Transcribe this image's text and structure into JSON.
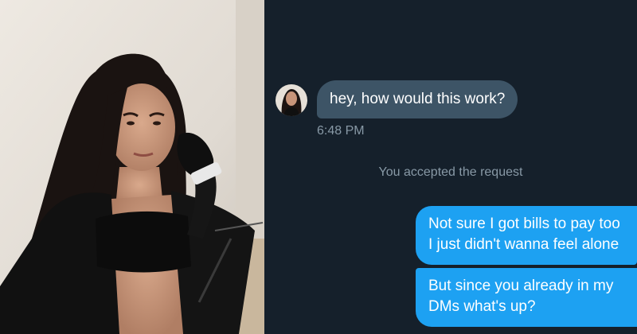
{
  "conversation": {
    "incoming_message": "hey, how would this work?",
    "incoming_time": "6:48 PM",
    "system_note": "You accepted the request",
    "outgoing_messages": [
      "Not sure I got bills to pay too I just didn't wanna feel alone",
      "But since you already in my DMs what's up?"
    ]
  },
  "colors": {
    "background": "#15202b",
    "incoming_bubble": "#3d5466",
    "outgoing_bubble": "#1da1f2",
    "muted_text": "#8899a6"
  },
  "icons": {
    "avatar": "profile-avatar"
  }
}
